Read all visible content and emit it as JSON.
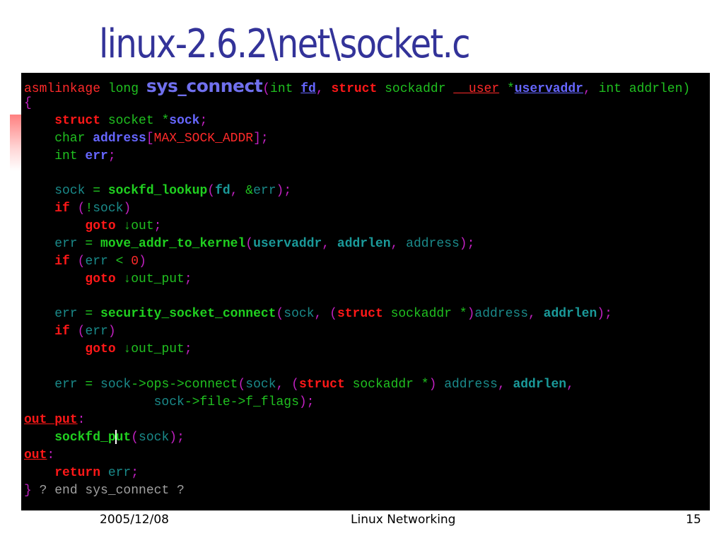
{
  "slide": {
    "title": "linux-2.6.2\\net\\socket.c",
    "footer": {
      "date": "2005/12/08",
      "center": "Linux Networking",
      "page_number": "15"
    }
  },
  "code_colors": {
    "background": "#000000",
    "keyword": "#ff1818",
    "type": "#20c020",
    "function": "#20d020",
    "identifier": "#1a8a8a",
    "punctuation": "#c020c0",
    "variable": "#6666ff",
    "comment": "#a0a0a0"
  },
  "code_lines": [
    [
      [
        "kwn",
        "asmlinkage "
      ],
      [
        "gr",
        "long "
      ],
      [
        "big",
        "sys_connect"
      ],
      [
        "pn",
        "("
      ],
      [
        "gr",
        "int "
      ],
      [
        "var ul",
        "fd"
      ],
      [
        "pn",
        ", "
      ],
      [
        "kw",
        "struct "
      ],
      [
        "gr",
        "sockaddr "
      ],
      [
        "kwn ul",
        "__user"
      ],
      [
        "pn",
        " "
      ],
      [
        "gr",
        "*"
      ],
      [
        "var ul",
        "uservaddr"
      ],
      [
        "pn",
        ", "
      ],
      [
        "gr",
        "int addrlen)"
      ]
    ],
    [
      [
        "pn",
        "{"
      ]
    ],
    [
      [
        "kw",
        "    struct "
      ],
      [
        "gr",
        "socket "
      ],
      [
        "gr",
        "*"
      ],
      [
        "var",
        "sock"
      ],
      [
        "pn",
        ";"
      ]
    ],
    [
      [
        "gr",
        "    char "
      ],
      [
        "var",
        "address"
      ],
      [
        "pn",
        "["
      ],
      [
        "kwn",
        "MAX_SOCK_ADDR"
      ],
      [
        "pn",
        "];"
      ]
    ],
    [
      [
        "gr",
        "    int "
      ],
      [
        "var",
        "err"
      ],
      [
        "pn",
        ";"
      ]
    ],
    [
      [
        "id",
        " "
      ]
    ],
    [
      [
        "id",
        "    sock "
      ],
      [
        "gr",
        "= "
      ],
      [
        "fn",
        "sockfd_lookup"
      ],
      [
        "pn",
        "("
      ],
      [
        "idb",
        "fd"
      ],
      [
        "pn",
        ", "
      ],
      [
        "gr",
        "&"
      ],
      [
        "id",
        "err"
      ],
      [
        "pn",
        ");"
      ]
    ],
    [
      [
        "kw",
        "    if "
      ],
      [
        "pn",
        "("
      ],
      [
        "gr",
        "!"
      ],
      [
        "id",
        "sock"
      ],
      [
        "pn",
        ")"
      ]
    ],
    [
      [
        "kw",
        "        goto "
      ],
      [
        "gr",
        "↓out"
      ],
      [
        "pn",
        ";"
      ]
    ],
    [
      [
        "id",
        "    err "
      ],
      [
        "gr",
        "= "
      ],
      [
        "fn",
        "move_addr_to_kernel"
      ],
      [
        "pn",
        "("
      ],
      [
        "idb",
        "uservaddr"
      ],
      [
        "pn",
        ", "
      ],
      [
        "idb",
        "addrlen"
      ],
      [
        "pn",
        ", "
      ],
      [
        "id",
        "address"
      ],
      [
        "pn",
        ");"
      ]
    ],
    [
      [
        "kw",
        "    if "
      ],
      [
        "pn",
        "("
      ],
      [
        "id",
        "err "
      ],
      [
        "gr",
        "< "
      ],
      [
        "num",
        "0"
      ],
      [
        "pn",
        ")"
      ]
    ],
    [
      [
        "kw",
        "        goto "
      ],
      [
        "gr",
        "↓out_put"
      ],
      [
        "pn",
        ";"
      ]
    ],
    [
      [
        "id",
        " "
      ]
    ],
    [
      [
        "id",
        "    err "
      ],
      [
        "gr",
        "= "
      ],
      [
        "fn",
        "security_socket_connect"
      ],
      [
        "pn",
        "("
      ],
      [
        "id",
        "sock"
      ],
      [
        "pn",
        ", "
      ],
      [
        "pn",
        "("
      ],
      [
        "kw",
        "struct "
      ],
      [
        "gr",
        "sockaddr "
      ],
      [
        "gr",
        "*"
      ],
      [
        "pn",
        ")"
      ],
      [
        "id",
        "address"
      ],
      [
        "pn",
        ", "
      ],
      [
        "idb",
        "addrlen"
      ],
      [
        "pn",
        ");"
      ]
    ],
    [
      [
        "kw",
        "    if "
      ],
      [
        "pn",
        "("
      ],
      [
        "id",
        "err"
      ],
      [
        "pn",
        ")"
      ]
    ],
    [
      [
        "kw",
        "        goto "
      ],
      [
        "gr",
        "↓out_put"
      ],
      [
        "pn",
        ";"
      ]
    ],
    [
      [
        "id",
        " "
      ]
    ],
    [
      [
        "id",
        "    err "
      ],
      [
        "gr",
        "= "
      ],
      [
        "id",
        "sock"
      ],
      [
        "gr",
        "->ops->connect"
      ],
      [
        "pn",
        "("
      ],
      [
        "id",
        "sock"
      ],
      [
        "pn",
        ", "
      ],
      [
        "pn",
        "("
      ],
      [
        "kw",
        "struct "
      ],
      [
        "gr",
        "sockaddr "
      ],
      [
        "gr",
        "*"
      ],
      [
        "pn",
        ") "
      ],
      [
        "id",
        "address"
      ],
      [
        "pn",
        ", "
      ],
      [
        "idb",
        "addrlen"
      ],
      [
        "pn",
        ","
      ]
    ],
    [
      [
        "id",
        "                 sock"
      ],
      [
        "gr",
        "->file->f_flags"
      ],
      [
        "pn",
        ");"
      ]
    ],
    [
      [
        "lbl",
        "out_put"
      ],
      [
        "pn",
        ":"
      ]
    ],
    [
      [
        "fn",
        "    sockfd_p"
      ],
      [
        "cursor",
        ""
      ],
      [
        "fn",
        "ut"
      ],
      [
        "pn",
        "("
      ],
      [
        "id",
        "sock"
      ],
      [
        "pn",
        ");"
      ]
    ],
    [
      [
        "lbl",
        "out"
      ],
      [
        "pn",
        ":"
      ]
    ],
    [
      [
        "kw",
        "    return "
      ],
      [
        "id",
        "err"
      ],
      [
        "pn",
        ";"
      ]
    ],
    [
      [
        "pn",
        "} "
      ],
      [
        "cm",
        "? end sys_connect ?"
      ]
    ]
  ]
}
